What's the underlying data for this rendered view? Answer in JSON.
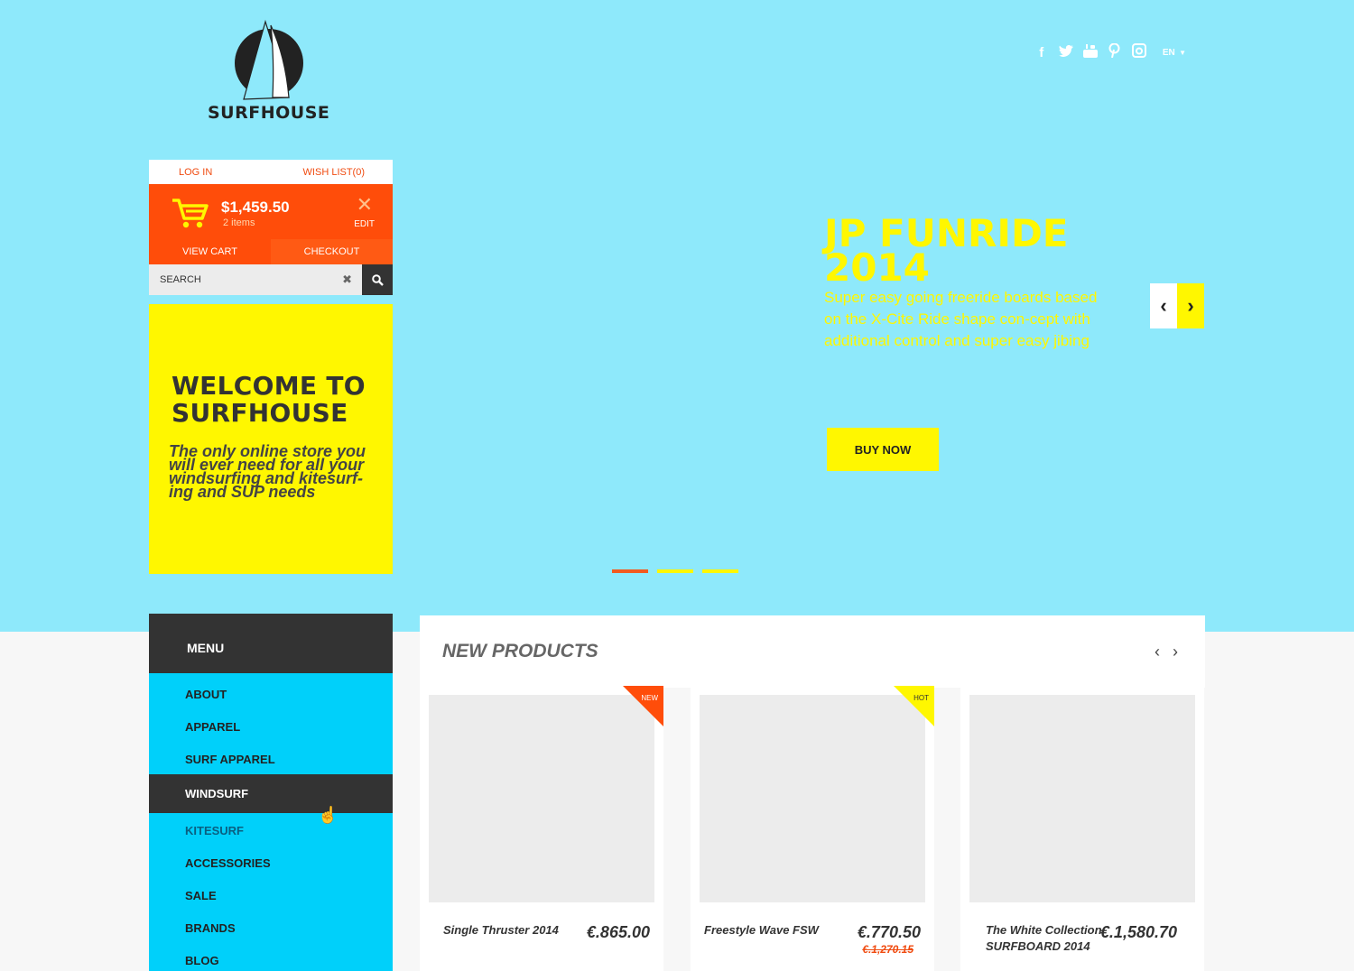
{
  "brand": {
    "name": "SURFHOUSE"
  },
  "header": {
    "social_icons": [
      "facebook-icon",
      "twitter-icon",
      "youtube-icon",
      "pinterest-icon",
      "instagram-icon"
    ],
    "language": "EN"
  },
  "account": {
    "login_label": "LOG IN",
    "wishlist_label": "WISH LIST(0)",
    "cart_total": "$1,459.50",
    "cart_items": "2 items",
    "edit_label": "EDIT",
    "view_cart_label": "VIEW CART",
    "checkout_label": "CHECKOUT"
  },
  "search": {
    "value": "SEARCH"
  },
  "welcome": {
    "title": "WELCOME TO SURFHOUSE",
    "text": "The only online store you will ever need for all your windsurfing and kitesurf-ing and SUP needs"
  },
  "slide": {
    "title": "JP FUNRIDE 2014",
    "text": "Super easy going freeride boards based on the X-Cite Ride shape con-cept with additional control and super easy jibing",
    "button": "BUY NOW",
    "dots": 3,
    "active_dot": 0
  },
  "menu": {
    "title": "MENU",
    "items": [
      "ABOUT",
      "APPAREL",
      "SURF APPAREL",
      "WINDSURF",
      "KITESURF",
      "ACCESSORIES",
      "SALE",
      "BRANDS",
      "BLOG"
    ],
    "active": "WINDSURF"
  },
  "products": {
    "title": "NEW PRODUCTS",
    "items": [
      {
        "name": "Single Thruster 2014",
        "price": "€.865.00",
        "old_price": "",
        "badge": "NEW"
      },
      {
        "name": "Freestyle Wave FSW",
        "price": "€.770.50",
        "old_price": "€.1,270.15",
        "badge": "HOT"
      },
      {
        "name": "The White Collection SURFBOARD 2014",
        "price": "€.1,580.70",
        "old_price": "",
        "badge": ""
      }
    ]
  },
  "colors": {
    "hero_bg": "#8ee9fb",
    "accent_orange": "#ff4d0a",
    "accent_yellow": "#fff700",
    "menu_cyan": "#00d0fa",
    "dark": "#333333"
  }
}
